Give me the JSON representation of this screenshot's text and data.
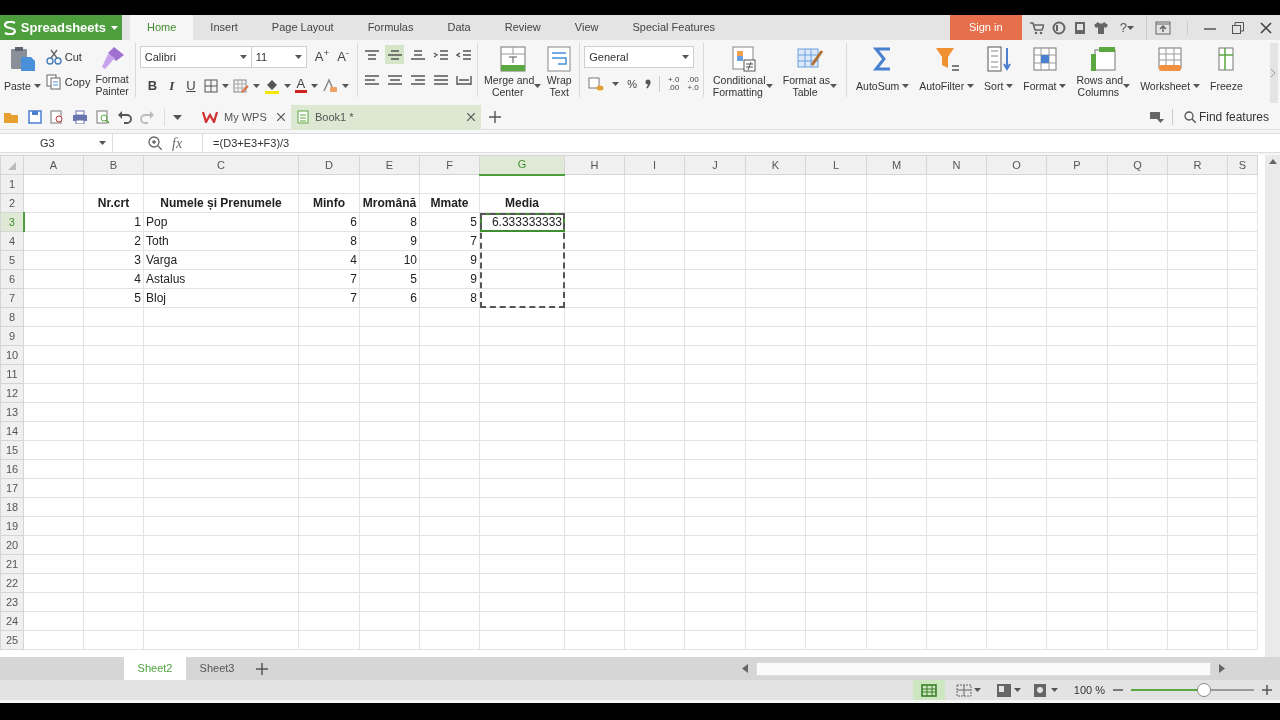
{
  "app_button": {
    "label": "Spreadsheets"
  },
  "ribbon_tabs": [
    {
      "label": "Home",
      "selected": true
    },
    {
      "label": "Insert",
      "selected": false
    },
    {
      "label": "Page Layout",
      "selected": false
    },
    {
      "label": "Formulas",
      "selected": false
    },
    {
      "label": "Data",
      "selected": false
    },
    {
      "label": "Review",
      "selected": false
    },
    {
      "label": "View",
      "selected": false
    },
    {
      "label": "Special Features",
      "selected": false
    }
  ],
  "sign_in": "Sign in",
  "help": "?",
  "clipboard": {
    "paste": "Paste",
    "cut": "Cut",
    "copy": "Copy",
    "format_painter": "Format\nPainter"
  },
  "font": {
    "name": "Calibri",
    "size": "11",
    "grow": "A$^{+}$",
    "shrink": "A$^{-}$",
    "bold": "B",
    "italic": "I",
    "underline": "U",
    "font_color_button": "A"
  },
  "alignment": {
    "buttons": [
      {
        "selected": false
      },
      {
        "selected": true
      },
      {
        "selected": false
      },
      {
        "selected": false
      },
      {
        "selected": false
      },
      {
        "selected": false
      },
      {
        "selected": false
      },
      {
        "selected": false
      },
      {
        "selected": false
      },
      {
        "selected": false
      }
    ],
    "merge": "Merge and\nCenter",
    "wrap": "Wrap\nText"
  },
  "number": {
    "format": "General",
    "percent": "%",
    "increase_decimal": "+.0\n.00",
    "decrease_decimal": ".00\n+.0"
  },
  "styles": [
    {
      "label": "Conditional\nFormatting",
      "dropdown": true
    },
    {
      "label": "Format as\nTable",
      "dropdown": true
    }
  ],
  "cells_tools": [
    {
      "label": "AutoSum",
      "dropdown": true
    },
    {
      "label": "AutoFilter",
      "dropdown": true
    },
    {
      "label": "Sort",
      "dropdown": true
    },
    {
      "label": "Format",
      "dropdown": true
    },
    {
      "label": "Rows and\nColumns",
      "dropdown": true
    },
    {
      "label": "Worksheet",
      "dropdown": true
    },
    {
      "label": "Freeze",
      "dropdown": false
    }
  ],
  "doc_tabs": [
    {
      "label": "My WPS",
      "selected": false
    },
    {
      "label": "Book1 *",
      "selected": true
    }
  ],
  "find_features": "Find features",
  "formula_bar": {
    "cell_ref": "G3",
    "fx_label": "fx",
    "formula": "=(D3+E3+F3)/3"
  },
  "columns": [
    {
      "label": "A",
      "selected": false
    },
    {
      "label": "B",
      "selected": false
    },
    {
      "label": "C",
      "selected": false
    },
    {
      "label": "D",
      "selected": false
    },
    {
      "label": "E",
      "selected": false
    },
    {
      "label": "F",
      "selected": false
    },
    {
      "label": "G",
      "selected": true
    },
    {
      "label": "H",
      "selected": false
    },
    {
      "label": "I",
      "selected": false
    },
    {
      "label": "J",
      "selected": false
    },
    {
      "label": "K",
      "selected": false
    },
    {
      "label": "L",
      "selected": false
    },
    {
      "label": "M",
      "selected": false
    },
    {
      "label": "N",
      "selected": false
    },
    {
      "label": "O",
      "selected": false
    },
    {
      "label": "P",
      "selected": false
    },
    {
      "label": "Q",
      "selected": false
    },
    {
      "label": "R",
      "selected": false
    },
    {
      "label": "S",
      "selected": false
    }
  ],
  "row_headers": [
    {
      "label": "1",
      "selected": false
    },
    {
      "label": "2",
      "selected": false
    },
    {
      "label": "3",
      "selected": true
    },
    {
      "label": "4",
      "selected": false
    },
    {
      "label": "5",
      "selected": false
    },
    {
      "label": "6",
      "selected": false
    },
    {
      "label": "7",
      "selected": false
    },
    {
      "label": "8",
      "selected": false
    },
    {
      "label": "9",
      "selected": false
    },
    {
      "label": "10",
      "selected": false
    },
    {
      "label": "11",
      "selected": false
    },
    {
      "label": "12",
      "selected": false
    },
    {
      "label": "13",
      "selected": false
    },
    {
      "label": "14",
      "selected": false
    },
    {
      "label": "15",
      "selected": false
    },
    {
      "label": "16",
      "selected": false
    },
    {
      "label": "17",
      "selected": false
    },
    {
      "label": "18",
      "selected": false
    },
    {
      "label": "19",
      "selected": false
    },
    {
      "label": "20",
      "selected": false
    },
    {
      "label": "21",
      "selected": false
    },
    {
      "label": "22",
      "selected": false
    },
    {
      "label": "23",
      "selected": false
    },
    {
      "label": "24",
      "selected": false
    },
    {
      "label": "25",
      "selected": false
    }
  ],
  "data_table": {
    "columns": [
      {
        "title": "Nr.crt",
        "kind": "number",
        "marked": false
      },
      {
        "title": "Numele și Prenumele",
        "kind": "text",
        "marked": false
      },
      {
        "title": "Minfo",
        "kind": "number",
        "marked": false
      },
      {
        "title": "Mromână",
        "kind": "number",
        "marked": false
      },
      {
        "title": "Mmate",
        "kind": "number",
        "marked": false
      },
      {
        "title": "Media",
        "kind": "number",
        "marked": true
      }
    ],
    "rows": [
      {
        "cells": [
          "1",
          "Pop",
          "6",
          "8",
          "5",
          "6.333333333"
        ]
      },
      {
        "cells": [
          "2",
          "Toth",
          "8",
          "9",
          "7"
        ]
      },
      {
        "cells": [
          "3",
          "Varga",
          "4",
          "10",
          "9"
        ]
      },
      {
        "cells": [
          "4",
          "Astalus",
          "7",
          "5",
          "9"
        ]
      },
      {
        "cells": [
          "5",
          "Bloj",
          "7",
          "6",
          "8"
        ]
      }
    ]
  },
  "sheet_tabs": [
    {
      "label": "Sheet2",
      "selected": true
    },
    {
      "label": "Sheet3",
      "selected": false
    }
  ],
  "status_bar": {
    "views": [
      {
        "selected": true
      },
      {
        "selected": false
      },
      {
        "selected": false
      }
    ],
    "zoom": "100 %",
    "zoom_slider": {
      "level": 0.59
    }
  }
}
